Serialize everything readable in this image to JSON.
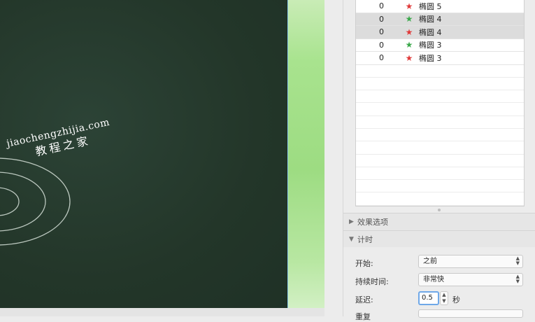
{
  "animation_list": {
    "rows": [
      {
        "delay": "0",
        "icon": "red-star-icon",
        "name": "椭圆 5",
        "selected": false
      },
      {
        "delay": "0",
        "icon": "green-star-icon",
        "name": "椭圆 4",
        "selected": true
      },
      {
        "delay": "0",
        "icon": "red-star-icon",
        "name": "椭圆 4",
        "selected": true
      },
      {
        "delay": "0",
        "icon": "green-star-icon",
        "name": "椭圆 3",
        "selected": false
      },
      {
        "delay": "0",
        "icon": "red-star-icon",
        "name": "椭圆 3",
        "selected": false
      }
    ]
  },
  "sections": {
    "effect_options": "效果选项",
    "timing": "计时"
  },
  "timing": {
    "start_label": "开始:",
    "start_value": "之前",
    "duration_label": "持续时间:",
    "duration_value": "非常快",
    "delay_label": "延迟:",
    "delay_value": "0.5",
    "delay_unit": "秒",
    "repeat_label": "重复"
  },
  "watermark": {
    "line1": "jiaochengzhijia.com",
    "line2": "教程之家"
  },
  "colors": {
    "slide_background": "#263a30",
    "accent_strip": "#a8e38e",
    "selection": "#dcdcdc",
    "focus_ring": "#6fa8e8"
  }
}
